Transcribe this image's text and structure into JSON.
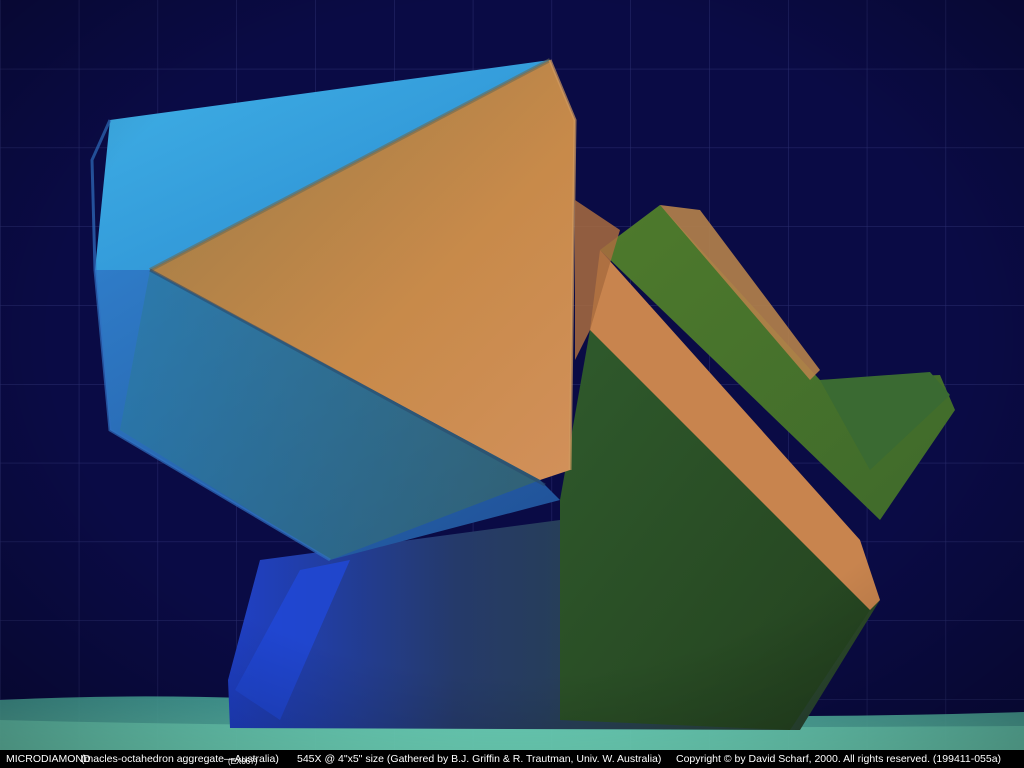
{
  "image": {
    "subject": "MICRODIAMOND",
    "subtitle": "(macles-octahedron aggregate—Australia)",
    "specimen_code": "(EX067)",
    "magnification": "545X @ 4\"x5\" size (Gathered by B.J. Griffin & R. Trautman, Univ. W. Australia)",
    "copyright": "Copyright © by David Scharf, 2000. All rights reserved.   (199411-055a)"
  },
  "colors": {
    "background": "#0a0b45",
    "grid": "#2a2d6e",
    "crystal_blue": "#2a7fd8",
    "crystal_orange": "#c7884a",
    "crystal_green": "#2f5a2c",
    "ground": "#5fd0b0"
  }
}
